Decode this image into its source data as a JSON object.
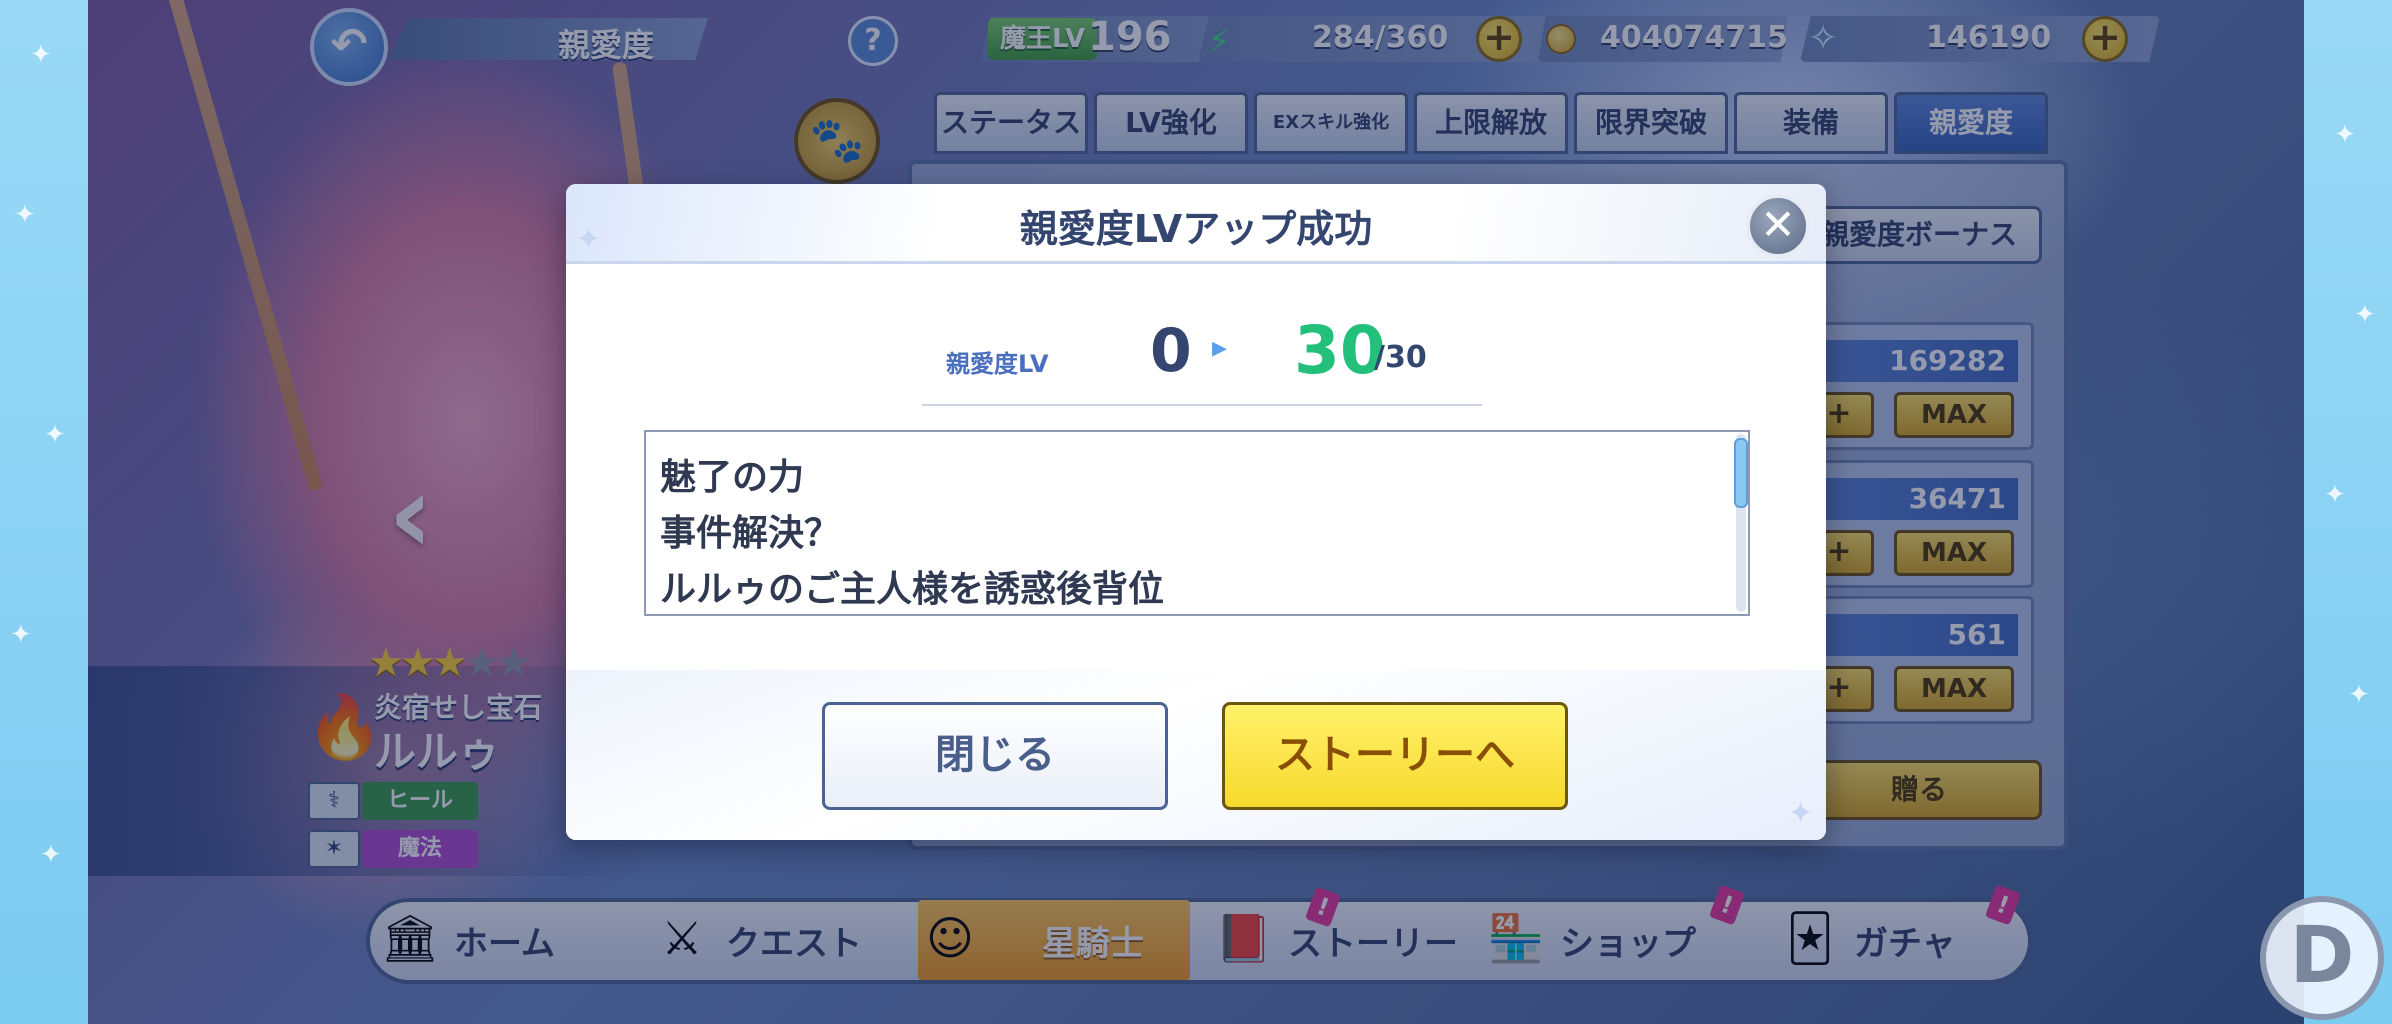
{
  "topbar": {
    "screen_title": "親愛度",
    "help_label": "?",
    "maou_lv_label": "魔王LV",
    "maou_lv_value": "196",
    "stamina": "284/360",
    "coins": "404074715",
    "gems": "146190",
    "plus_label": "+"
  },
  "tabs": [
    {
      "label": "ステータス"
    },
    {
      "label": "LV強化"
    },
    {
      "label": "EXスキル強化"
    },
    {
      "label": "上限解放"
    },
    {
      "label": "限界突破"
    },
    {
      "label": "装備"
    },
    {
      "label": "親愛度"
    }
  ],
  "side_panel": {
    "bonus_label": "親愛度ボーナス",
    "gifts": [
      {
        "value": "169282",
        "plus": "+",
        "max": "MAX"
      },
      {
        "value": "36471",
        "plus": "+",
        "max": "MAX"
      },
      {
        "value": "561",
        "plus": "+",
        "max": "MAX"
      }
    ],
    "give_label": "贈る"
  },
  "character": {
    "stars": 3,
    "stars_total": 5,
    "title": "炎宿せし宝石",
    "name": "ルルゥ",
    "roles": [
      {
        "label": "ヒール",
        "color": "#3a9a48"
      },
      {
        "label": "魔法",
        "color": "#b04ccf"
      }
    ]
  },
  "modal": {
    "title": "親愛度LVアップ成功",
    "lv_label": "親愛度LV",
    "lv_old": "0",
    "lv_new": "30",
    "lv_max": "/30",
    "stories": [
      "魅了の力",
      "事件解決？",
      "ルルゥのご主人様を誘惑後背位"
    ],
    "close_button": "閉じる",
    "story_button": "ストーリーへ"
  },
  "nav": [
    {
      "label": "ホーム",
      "icon": "home-icon",
      "glyph": "🏛",
      "active": false,
      "badge": false
    },
    {
      "label": "クエスト",
      "icon": "quest-icon",
      "glyph": "⚔",
      "active": false,
      "badge": false
    },
    {
      "label": "星騎士",
      "icon": "knight-icon",
      "glyph": "☺",
      "active": true,
      "badge": false
    },
    {
      "label": "ストーリー",
      "icon": "story-book-icon",
      "glyph": "📕",
      "active": false,
      "badge": true
    },
    {
      "label": "ショップ",
      "icon": "shop-icon",
      "glyph": "🏪",
      "active": false,
      "badge": true
    },
    {
      "label": "ガチャ",
      "icon": "gacha-icon",
      "glyph": "🃏",
      "active": false,
      "badge": true
    }
  ],
  "badge_mark": "!",
  "d_button": "D",
  "colors": {
    "accent_green": "#22c07a",
    "tab_active": "#3561b9",
    "story_button": "#f6d92c"
  }
}
